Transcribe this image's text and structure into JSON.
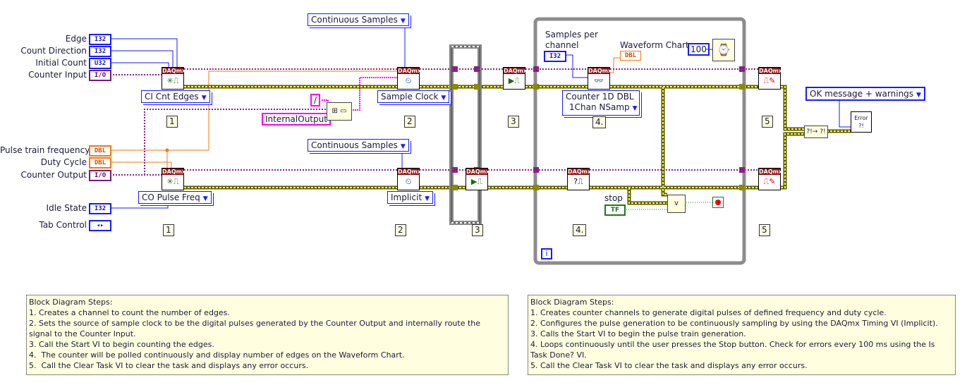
{
  "inputs_top": [
    {
      "label": "Edge",
      "type": "I32"
    },
    {
      "label": "Count Direction",
      "type": "I32"
    },
    {
      "label": "Initial Count",
      "type": "U32"
    },
    {
      "label": "Counter Input",
      "type": "I/O"
    }
  ],
  "inputs_bottom": [
    {
      "label": "Pulse train frequency",
      "type": "DBL"
    },
    {
      "label": "Duty Cycle",
      "type": "DBL"
    },
    {
      "label": "Counter Output",
      "type": "I/O"
    },
    {
      "label": "Idle State",
      "type": "I32"
    },
    {
      "label": "Tab Control",
      "type": "◂▸"
    }
  ],
  "daqmx_header": "DAQmx",
  "rings": {
    "ci_cnt_edges": "CI Cnt Edges",
    "co_pulse_freq": "CO Pulse Freq",
    "continuous_top": "Continuous Samples",
    "continuous_bottom": "Continuous Samples",
    "sample_clock": "Sample Clock",
    "implicit": "Implicit",
    "read_type_line1": "Counter 1D DBL",
    "read_type_line2": "1Chan NSamp",
    "error_dialog": "OK message + warnings"
  },
  "constants": {
    "slash": "/",
    "internal_output": "InternalOutput",
    "wait_ms": "100",
    "i32": "I32",
    "dbl": "DBL",
    "tf": "TF"
  },
  "labels": {
    "samples_per_channel": "Samples per channel",
    "waveform_chart": "Waveform Chart",
    "stop": "stop",
    "iteration": "i",
    "error": "Error ?!",
    "or": "v"
  },
  "steps": {
    "s1": "1",
    "s2": "2",
    "s3": "3",
    "s4": "4.",
    "s5": "5"
  },
  "notes": {
    "left": {
      "title": "Block Diagram Steps:",
      "lines": [
        "1. Creates a channel to count the number of edges.",
        "2. Sets the source of sample clock to be the digital pulses generated by the Counter Output and internally route the signal to the Counter Input.",
        "3. Call the Start VI to begin counting the edges.",
        "4.  The counter will be polled continuously and display number of edges on the Waveform Chart.",
        "5.  Call the Clear Task VI to clear the task and displays any error occurs."
      ]
    },
    "right": {
      "title": "Block Diagram Steps:",
      "lines": [
        "1. Creates counter channels to generate digital pulses of defined frequency and duty cycle.",
        "2. Configures the pulse generation to be continuously sampling by using the DAQmx Timing VI (Implicit).",
        "3. Calls the Start VI to begin the pulse train generation.",
        "4. Loops continuously until the user presses the Stop button. Check for errors every 100 ms using the Is Task Done? VI.",
        "5. Call the Clear Task VI to clear the task and displays any error occurs."
      ]
    }
  },
  "colors": {
    "integer": "#1a1aff",
    "double": "#f07a10",
    "task": "#8a1f8a",
    "error_wire": "#d8d800",
    "string": "#ff00ff",
    "boolean": "#1a7a1a",
    "daqmx_header": "#8b1010"
  }
}
